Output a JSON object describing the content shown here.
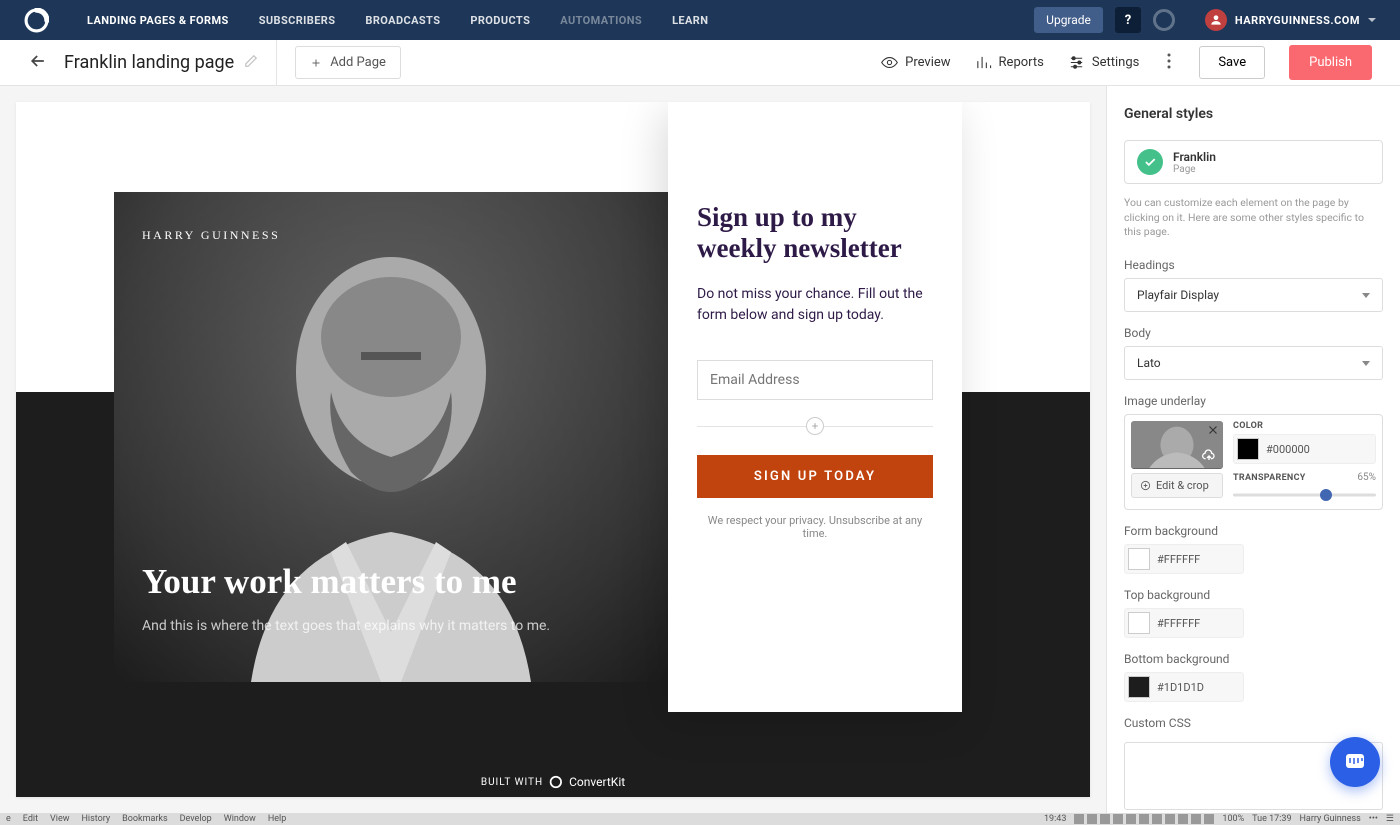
{
  "topnav": {
    "items": [
      "LANDING PAGES & FORMS",
      "SUBSCRIBERS",
      "BROADCASTS",
      "PRODUCTS",
      "AUTOMATIONS",
      "LEARN"
    ],
    "upgrade": "Upgrade",
    "help": "?",
    "user": "HARRYGUINNESS.COM"
  },
  "subheader": {
    "title": "Franklin landing page",
    "add_page": "Add Page",
    "preview": "Preview",
    "reports": "Reports",
    "settings": "Settings",
    "save": "Save",
    "publish": "Publish"
  },
  "landing": {
    "brand": "HARRY GUINNESS",
    "hero_heading": "Your work matters to me",
    "hero_sub": "And this is where the text goes that explains why it matters to me.",
    "form_headline": "Sign up to my weekly newsletter",
    "form_desc": "Do not miss your chance. Fill out the form below and sign up today.",
    "email_placeholder": "Email Address",
    "submit": "SIGN UP TODAY",
    "privacy": "We respect your privacy. Unsubscribe at any time.",
    "built_with": "BUILT WITH",
    "built_brand": "ConvertKit"
  },
  "sidebar": {
    "title": "General styles",
    "template_name": "Franklin",
    "template_type": "Page",
    "help_text": "You can customize each element on the page by clicking on it. Here are some other styles specific to this page.",
    "headings_label": "Headings",
    "headings_value": "Playfair Display",
    "body_label": "Body",
    "body_value": "Lato",
    "image_underlay_label": "Image underlay",
    "edit_crop": "Edit & crop",
    "color_label": "COLOR",
    "underlay_color": "#000000",
    "transparency_label": "TRANSPARENCY",
    "transparency_value": "65%",
    "transparency_pct": 65,
    "form_bg_label": "Form background",
    "form_bg": "#FFFFFF",
    "top_bg_label": "Top background",
    "top_bg": "#FFFFFF",
    "bottom_bg_label": "Bottom background",
    "bottom_bg": "#1D1D1D",
    "custom_css_label": "Custom CSS"
  },
  "osbar": {
    "menu": [
      "e",
      "Edit",
      "View",
      "History",
      "Bookmarks",
      "Develop",
      "Window",
      "Help"
    ],
    "time_left": "19:43",
    "battery": "100%",
    "time_right": "Tue 17:39",
    "user": "Harry Guinness"
  }
}
